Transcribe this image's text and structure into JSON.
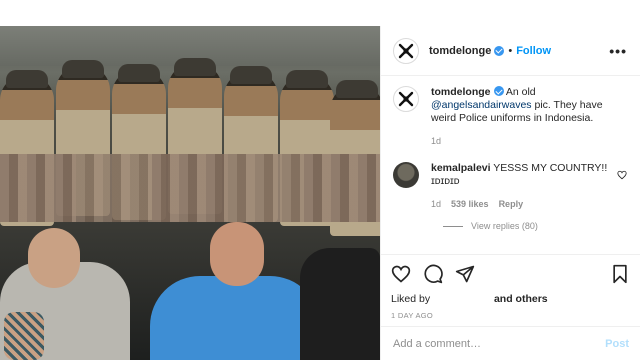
{
  "post": {
    "author": "tomdelonge",
    "follow_label": "Follow",
    "separator": "•",
    "more_label": "•••"
  },
  "caption": {
    "username": "tomdelonge",
    "text_prefix": "An old ",
    "mention": "@angelsandairwaves",
    "text_suffix": " pic. They have weird Police uniforms in Indonesia.",
    "time": "1d"
  },
  "comments": [
    {
      "username": "kemalpalevi",
      "text": "YESSS MY COUNTRY!! ɪᴅɪᴅɪᴅ",
      "time": "1d",
      "likes": "539 likes",
      "reply_label": "Reply",
      "view_replies": "View replies (80)"
    }
  ],
  "actions": {
    "liked_by_prefix": "Liked by",
    "liked_by_suffix": "and others",
    "timeago": "1 DAY AGO"
  },
  "composer": {
    "placeholder": "Add a comment…",
    "post_label": "Post"
  },
  "colors": {
    "accent": "#0095f6",
    "verified": "#3897f0",
    "post_disabled": "#b2dffc"
  },
  "icons": {
    "header_avatar": "logo-avatar-icon",
    "verified": "verified-badge-icon",
    "like": "heart-icon",
    "comment": "comment-bubble-icon",
    "share": "paper-plane-icon",
    "save": "bookmark-icon",
    "more": "more-options-icon"
  }
}
